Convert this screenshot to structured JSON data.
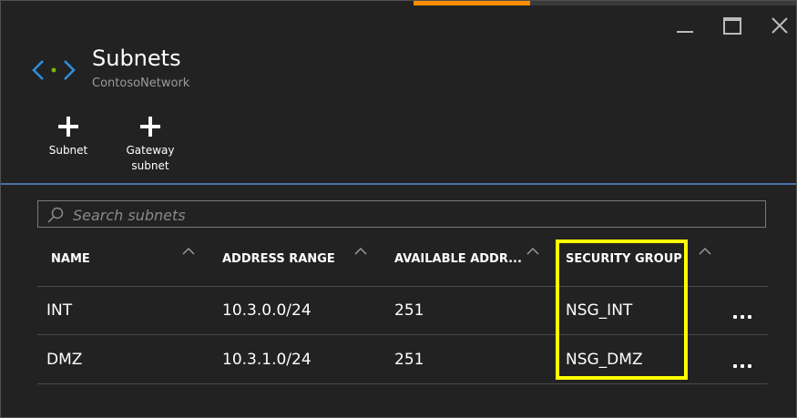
{
  "blade": {
    "title": "Subnets",
    "subtitle": "ContosoNetwork"
  },
  "commands": {
    "subnet_label": "Subnet",
    "gateway_label_line1": "Gateway",
    "gateway_label_line2": "subnet"
  },
  "search": {
    "placeholder": "Search subnets",
    "value": ""
  },
  "table": {
    "columns": [
      "NAME",
      "ADDRESS RANGE",
      "AVAILABLE ADDR...",
      "SECURITY GROUP"
    ],
    "rows": [
      {
        "name": "INT",
        "address_range": "10.3.0.0/24",
        "available": "251",
        "security_group": "NSG_INT"
      },
      {
        "name": "DMZ",
        "address_range": "10.3.1.0/24",
        "available": "251",
        "security_group": "NSG_DMZ"
      }
    ]
  },
  "icons": {
    "header": "virtual-network-icon",
    "commands": "plus-icon",
    "search": "search-icon",
    "sort": "chevron-up-icon",
    "row_menu": "ellipsis-icon"
  },
  "colors": {
    "background": "#222222",
    "accent": "#ff8c00",
    "divider": "#4a6fa8",
    "vnet_icon": "#2f8fdf",
    "vnet_dot": "#7ab800",
    "highlight": "#ffff00"
  }
}
